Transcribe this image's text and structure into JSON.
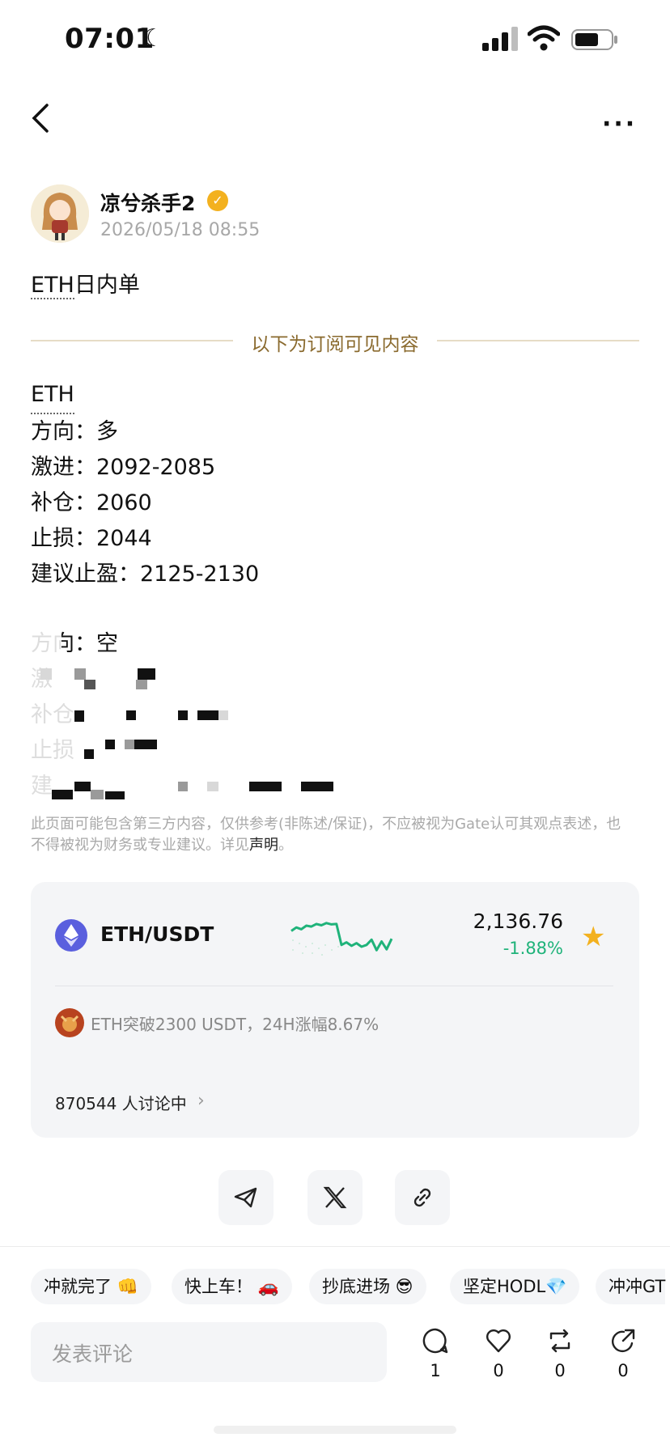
{
  "status_bar": {
    "time": "07:01"
  },
  "post": {
    "author": "凉兮杀手2",
    "date": "2026/05/18 08:55",
    "title": "ETH日内单",
    "subscribe_label": "以下为订阅可见内容",
    "lines": [
      "ETH",
      "方向：多",
      "激进：2092-2085",
      "补仓：2060",
      "止损：2044",
      "建议止盈：2125-2130"
    ],
    "blurred_lines": [
      "方向：空",
      "激",
      "补仓",
      "止损",
      "建"
    ],
    "disclaimer_text": "此页面可能包含第三方内容，仅供参考(非陈述/保证)，不应被视为Gate认可其观点表述，也不得被视为财务或专业建议。详见",
    "disclaimer_link": "声明",
    "disclaimer_end": "。"
  },
  "ticker": {
    "pair": "ETH/USDT",
    "price": "2,136.76",
    "change": "-1.88%",
    "news": "ETH突破2300 USDT，24H涨幅8.67%",
    "discussing": "870544 人讨论中",
    "spark": [
      0.62,
      0.7,
      0.66,
      0.74,
      0.72,
      0.78,
      0.75,
      0.8,
      0.77,
      0.78,
      0.3,
      0.36,
      0.28,
      0.34,
      0.26,
      0.3,
      0.42,
      0.18,
      0.38,
      0.2,
      0.44
    ],
    "colors": {
      "up": "#1fb37a",
      "accent": "#5a5fde"
    }
  },
  "share_buttons": [
    "telegram-icon",
    "x-icon",
    "link-icon"
  ],
  "tags": [
    "冲就完了 👊",
    "快上车！ 🚗",
    "抄底进场 😎",
    "坚定HODL💎",
    "冲冲GT"
  ],
  "comment": {
    "placeholder": "发表评论"
  },
  "actions": {
    "comments": "1",
    "likes": "0",
    "reposts": "0",
    "shares": "0"
  }
}
